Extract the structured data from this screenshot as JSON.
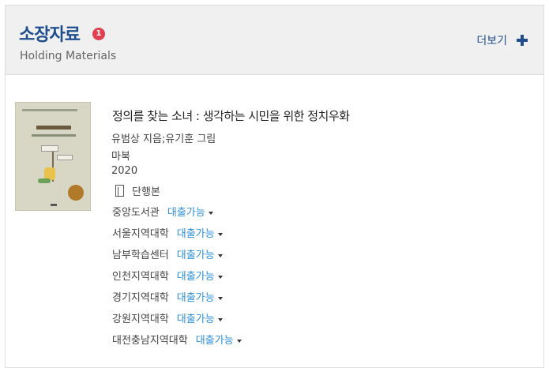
{
  "header": {
    "title": "소장자료",
    "badge": "1",
    "subtitle": "Holding Materials",
    "more_label": "더보기"
  },
  "book": {
    "title": "정의를 찾는 소녀 : 생각하는 시민을 위한 정치우화",
    "author": "유범상 지음;유기훈 그림",
    "publisher": "마북",
    "year": "2020",
    "format": "단행본"
  },
  "holdings": [
    {
      "library": "중앙도서관",
      "status": "대출가능"
    },
    {
      "library": "서울지역대학",
      "status": "대출가능"
    },
    {
      "library": "남부학습센터",
      "status": "대출가능"
    },
    {
      "library": "인천지역대학",
      "status": "대출가능"
    },
    {
      "library": "경기지역대학",
      "status": "대출가능"
    },
    {
      "library": "강원지역대학",
      "status": "대출가능"
    },
    {
      "library": "대전충남지역대학",
      "status": "대출가능"
    }
  ]
}
